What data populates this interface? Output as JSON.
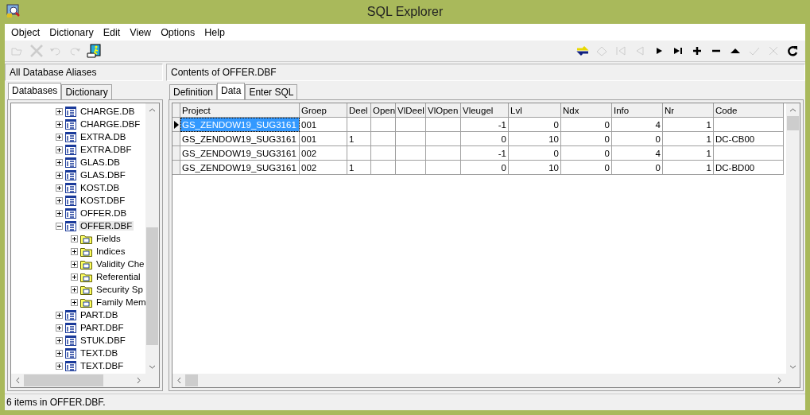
{
  "window": {
    "title": "SQL Explorer"
  },
  "menu": [
    "Object",
    "Dictionary",
    "Edit",
    "View",
    "Options",
    "Help"
  ],
  "toolbar_left": [
    {
      "kind": "open",
      "disabled": true
    },
    {
      "kind": "delete",
      "disabled": true
    },
    {
      "kind": "undo",
      "disabled": true
    },
    {
      "kind": "redo",
      "disabled": true
    },
    {
      "kind": "run",
      "disabled": false
    }
  ],
  "toolbar_right": [
    {
      "kind": "apply",
      "disabled": false
    },
    {
      "kind": "revert",
      "disabled": true
    },
    {
      "kind": "first",
      "disabled": true
    },
    {
      "kind": "prior",
      "disabled": true
    },
    {
      "kind": "next",
      "disabled": false
    },
    {
      "kind": "last",
      "disabled": false
    },
    {
      "kind": "insert",
      "disabled": false
    },
    {
      "kind": "remove",
      "disabled": false
    },
    {
      "kind": "edit",
      "disabled": false
    },
    {
      "kind": "post",
      "disabled": true
    },
    {
      "kind": "cancel",
      "disabled": true
    },
    {
      "kind": "refresh",
      "disabled": false
    }
  ],
  "left_header": "All Database Aliases",
  "right_header": "Contents of OFFER.DBF",
  "left_tabs": [
    {
      "label": "Databases",
      "selected": true
    },
    {
      "label": "Dictionary",
      "selected": false
    }
  ],
  "tree": [
    {
      "label": "CHARGE.DB",
      "expanded": false,
      "selected": false
    },
    {
      "label": "CHARGE.DBF",
      "expanded": false,
      "selected": false
    },
    {
      "label": "EXTRA.DB",
      "expanded": false,
      "selected": false
    },
    {
      "label": "EXTRA.DBF",
      "expanded": false,
      "selected": false
    },
    {
      "label": "GLAS.DB",
      "expanded": false,
      "selected": false
    },
    {
      "label": "GLAS.DBF",
      "expanded": false,
      "selected": false
    },
    {
      "label": "KOST.DB",
      "expanded": false,
      "selected": false
    },
    {
      "label": "KOST.DBF",
      "expanded": false,
      "selected": false
    },
    {
      "label": "OFFER.DB",
      "expanded": false,
      "selected": false
    },
    {
      "label": "OFFER.DBF",
      "expanded": true,
      "selected": true,
      "children": [
        {
          "label": "Fields",
          "expanded": false,
          "selected": false
        },
        {
          "label": "Indices",
          "expanded": false,
          "selected": false
        },
        {
          "label": "Validity Che",
          "expanded": false,
          "selected": false
        },
        {
          "label": "Referential",
          "expanded": false,
          "selected": false
        },
        {
          "label": "Security Sp",
          "expanded": false,
          "selected": false
        },
        {
          "label": "Family Mem",
          "expanded": false,
          "selected": false
        }
      ]
    },
    {
      "label": "PART.DB",
      "expanded": false,
      "selected": false
    },
    {
      "label": "PART.DBF",
      "expanded": false,
      "selected": false
    },
    {
      "label": "STUK.DBF",
      "expanded": false,
      "selected": false
    },
    {
      "label": "TEXT.DB",
      "expanded": false,
      "selected": false
    },
    {
      "label": "TEXT.DBF",
      "expanded": false,
      "selected": false
    }
  ],
  "right_tabs": [
    {
      "label": "Definition",
      "selected": false
    },
    {
      "label": "Data",
      "selected": true
    },
    {
      "label": "Enter SQL",
      "selected": false
    }
  ],
  "table": {
    "columns": [
      "Project",
      "Groep",
      "Deel",
      "Open",
      "VlDeel",
      "VlOpen",
      "Vleugel",
      "Lvl",
      "Ndx",
      "Info",
      "Nr",
      "Code"
    ],
    "rows": [
      {
        "selected": true,
        "cells": [
          "GS_ZENDOW19_SUG3161",
          "001",
          "",
          "",
          "",
          "",
          "-1",
          "0",
          "0",
          "4",
          "1",
          ""
        ]
      },
      {
        "selected": false,
        "cells": [
          "GS_ZENDOW19_SUG3161",
          "001",
          "1",
          "",
          "",
          "",
          "0",
          "10",
          "0",
          "0",
          "1",
          "DC-CB00"
        ]
      },
      {
        "selected": false,
        "cells": [
          "GS_ZENDOW19_SUG3161",
          "002",
          "",
          "",
          "",
          "",
          "-1",
          "0",
          "0",
          "4",
          "1",
          ""
        ]
      },
      {
        "selected": false,
        "cells": [
          "GS_ZENDOW19_SUG3161",
          "002",
          "1",
          "",
          "",
          "",
          "0",
          "10",
          "0",
          "0",
          "1",
          "DC-BD00"
        ]
      }
    ]
  },
  "status_bar": "6 items in OFFER.DBF."
}
